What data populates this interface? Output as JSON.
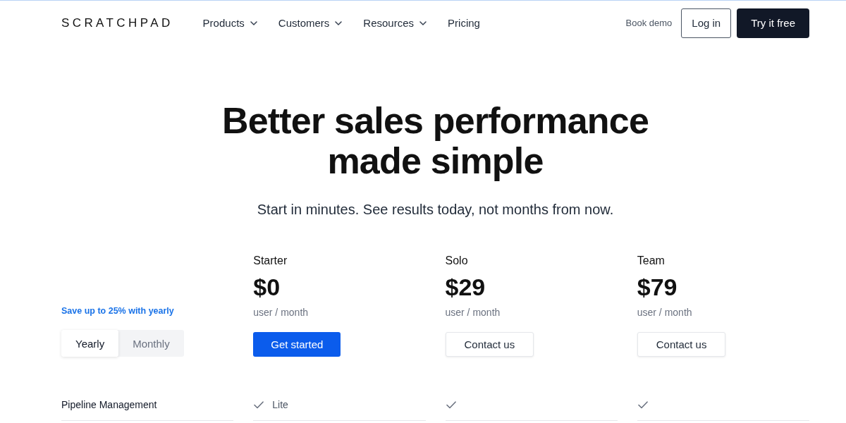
{
  "nav": {
    "logo": "SCRATCHPAD",
    "links": [
      {
        "label": "Products",
        "has_menu": true
      },
      {
        "label": "Customers",
        "has_menu": true
      },
      {
        "label": "Resources",
        "has_menu": true
      },
      {
        "label": "Pricing",
        "has_menu": false
      }
    ],
    "book_demo": "Book demo",
    "login": "Log in",
    "cta": "Try it free"
  },
  "hero": {
    "title": "Better sales performance made simple",
    "subtitle": "Start in minutes. See results today, not months from now."
  },
  "billing": {
    "note": "Save up to 25% with yearly",
    "options": [
      {
        "label": "Yearly",
        "selected": true
      },
      {
        "label": "Monthly",
        "selected": false
      }
    ]
  },
  "plans": [
    {
      "name": "Starter",
      "price": "$0",
      "period": "user / month",
      "button": {
        "label": "Get started",
        "kind": "primary"
      }
    },
    {
      "name": "Solo",
      "price": "$29",
      "period": "user / month",
      "button": {
        "label": "Contact us",
        "kind": "outline"
      }
    },
    {
      "name": "Team",
      "price": "$79",
      "period": "user / month",
      "button": {
        "label": "Contact us",
        "kind": "outline"
      }
    }
  ],
  "features": [
    {
      "name": "Pipeline Management",
      "cells": [
        {
          "included": true,
          "text": "Lite"
        },
        {
          "included": true
        },
        {
          "included": true
        }
      ]
    }
  ]
}
